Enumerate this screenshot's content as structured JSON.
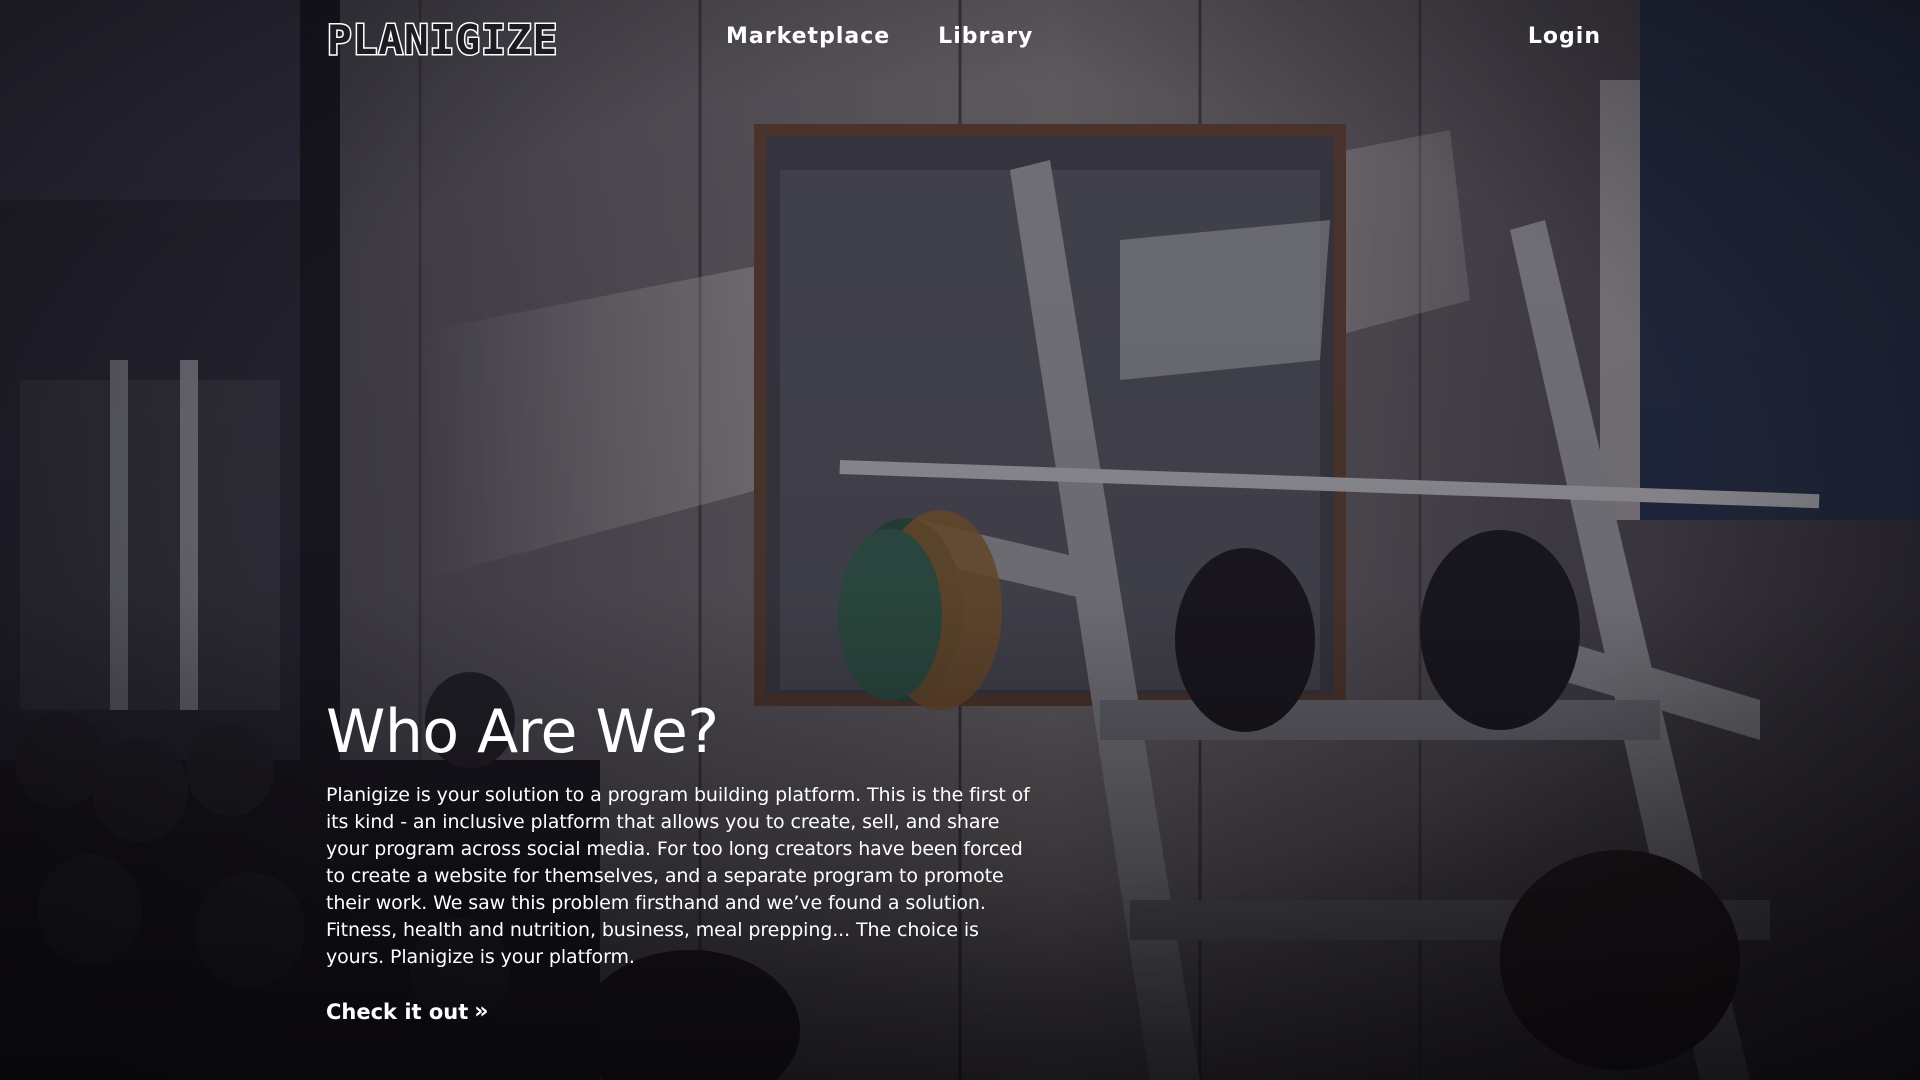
{
  "header": {
    "logo_text": "PLANIGIZE",
    "nav": [
      "Marketplace",
      "Library"
    ],
    "login_label": "Login"
  },
  "hero": {
    "title": "Who Are We?",
    "body": "Planigize is your solution to a program building platform. This is the first of its kind - an inclusive platform that allows you to create, sell, and share your program across social media. For too long creators have been forced to create a website for themselves, and a separate program to promote their work. We saw this problem firsthand and we’ve found a solution. Fitness, health and nutrition, business, meal prepping... The choice is yours. Planigize is your platform.",
    "cta_label": "Check it out"
  },
  "icons": {
    "cta_arrow": "double-chevron-right-icon"
  },
  "colors": {
    "text": "#ffffff",
    "background_dark": "#1b1a20"
  }
}
